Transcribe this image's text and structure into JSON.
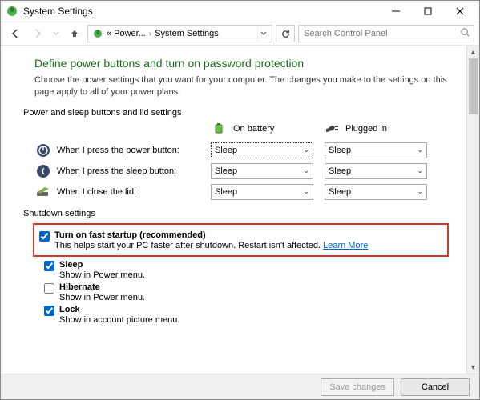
{
  "window": {
    "title": "System Settings"
  },
  "breadcrumb": {
    "trunc": "«",
    "item1": "Power...",
    "item2": "System Settings"
  },
  "search": {
    "placeholder": "Search Control Panel"
  },
  "page": {
    "heading": "Define power buttons and turn on password protection",
    "description": "Choose the power settings that you want for your computer. The changes you make to the settings on this page apply to all of your power plans.",
    "section_buttons": "Power and sleep buttons and lid settings",
    "columns": {
      "battery": "On battery",
      "plugged": "Plugged in"
    },
    "rows": [
      {
        "key": "power_button",
        "label": "When I press the power button:",
        "battery": "Sleep",
        "plugged": "Sleep"
      },
      {
        "key": "sleep_button",
        "label": "When I press the sleep button:",
        "battery": "Sleep",
        "plugged": "Sleep"
      },
      {
        "key": "close_lid",
        "label": "When I close the lid:",
        "battery": "Sleep",
        "plugged": "Sleep"
      }
    ],
    "section_shutdown": "Shutdown settings",
    "shutdown": {
      "fast_startup": {
        "checked": true,
        "label": "Turn on fast startup (recommended)",
        "desc_pre": "This helps start your PC faster after shutdown. Restart isn't affected. ",
        "learn_more": "Learn More"
      },
      "sleep": {
        "checked": true,
        "label": "Sleep",
        "sub": "Show in Power menu."
      },
      "hibernate": {
        "checked": false,
        "label": "Hibernate",
        "sub": "Show in Power menu."
      },
      "lock": {
        "checked": true,
        "label": "Lock",
        "sub": "Show in account picture menu."
      }
    }
  },
  "footer": {
    "save": "Save changes",
    "cancel": "Cancel"
  }
}
